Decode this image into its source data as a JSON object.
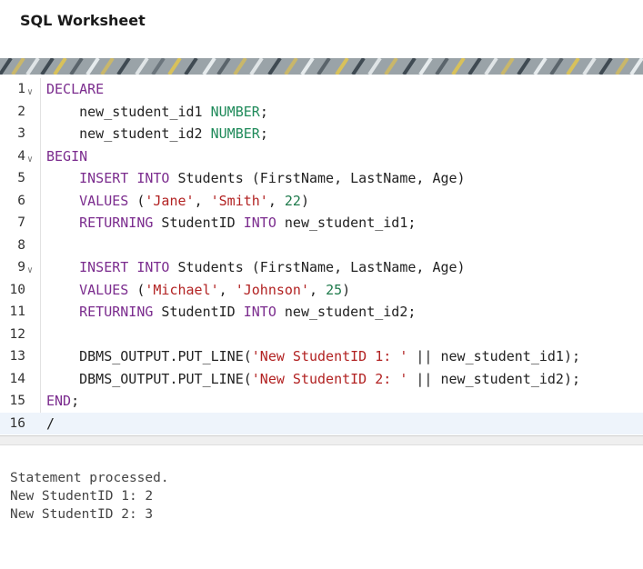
{
  "header": {
    "title": "SQL Worksheet"
  },
  "editor": {
    "lines": [
      {
        "n": "1",
        "fold": true,
        "tokens": [
          {
            "t": "DECLARE",
            "c": "kw"
          }
        ]
      },
      {
        "n": "2",
        "fold": false,
        "tokens": [
          {
            "t": "    new_student_id1 ",
            "c": ""
          },
          {
            "t": "NUMBER",
            "c": "ty"
          },
          {
            "t": ";",
            "c": ""
          }
        ]
      },
      {
        "n": "3",
        "fold": false,
        "tokens": [
          {
            "t": "    new_student_id2 ",
            "c": ""
          },
          {
            "t": "NUMBER",
            "c": "ty"
          },
          {
            "t": ";",
            "c": ""
          }
        ]
      },
      {
        "n": "4",
        "fold": true,
        "tokens": [
          {
            "t": "BEGIN",
            "c": "kw"
          }
        ]
      },
      {
        "n": "5",
        "fold": false,
        "tokens": [
          {
            "t": "    ",
            "c": ""
          },
          {
            "t": "INSERT INTO",
            "c": "kw"
          },
          {
            "t": " Students (FirstName, LastName, Age)",
            "c": ""
          }
        ]
      },
      {
        "n": "6",
        "fold": false,
        "tokens": [
          {
            "t": "    ",
            "c": ""
          },
          {
            "t": "VALUES",
            "c": "kw"
          },
          {
            "t": " (",
            "c": ""
          },
          {
            "t": "'Jane'",
            "c": "st"
          },
          {
            "t": ", ",
            "c": ""
          },
          {
            "t": "'Smith'",
            "c": "st"
          },
          {
            "t": ", ",
            "c": ""
          },
          {
            "t": "22",
            "c": "nm"
          },
          {
            "t": ")",
            "c": ""
          }
        ]
      },
      {
        "n": "7",
        "fold": false,
        "tokens": [
          {
            "t": "    ",
            "c": ""
          },
          {
            "t": "RETURNING",
            "c": "kw"
          },
          {
            "t": " StudentID ",
            "c": ""
          },
          {
            "t": "INTO",
            "c": "kw"
          },
          {
            "t": " new_student_id1;",
            "c": ""
          }
        ]
      },
      {
        "n": "8",
        "fold": false,
        "tokens": []
      },
      {
        "n": "9",
        "fold": true,
        "tokens": [
          {
            "t": "    ",
            "c": ""
          },
          {
            "t": "INSERT INTO",
            "c": "kw"
          },
          {
            "t": " Students (FirstName, LastName, Age)",
            "c": ""
          }
        ]
      },
      {
        "n": "10",
        "fold": false,
        "tokens": [
          {
            "t": "    ",
            "c": ""
          },
          {
            "t": "VALUES",
            "c": "kw"
          },
          {
            "t": " (",
            "c": ""
          },
          {
            "t": "'Michael'",
            "c": "st"
          },
          {
            "t": ", ",
            "c": ""
          },
          {
            "t": "'Johnson'",
            "c": "st"
          },
          {
            "t": ", ",
            "c": ""
          },
          {
            "t": "25",
            "c": "nm"
          },
          {
            "t": ")",
            "c": ""
          }
        ]
      },
      {
        "n": "11",
        "fold": false,
        "tokens": [
          {
            "t": "    ",
            "c": ""
          },
          {
            "t": "RETURNING",
            "c": "kw"
          },
          {
            "t": " StudentID ",
            "c": ""
          },
          {
            "t": "INTO",
            "c": "kw"
          },
          {
            "t": " new_student_id2;",
            "c": ""
          }
        ]
      },
      {
        "n": "12",
        "fold": false,
        "tokens": []
      },
      {
        "n": "13",
        "fold": false,
        "tokens": [
          {
            "t": "    DBMS_OUTPUT.PUT_LINE(",
            "c": ""
          },
          {
            "t": "'New StudentID 1: '",
            "c": "st"
          },
          {
            "t": " || new_student_id1);",
            "c": ""
          }
        ]
      },
      {
        "n": "14",
        "fold": false,
        "tokens": [
          {
            "t": "    DBMS_OUTPUT.PUT_LINE(",
            "c": ""
          },
          {
            "t": "'New StudentID 2: '",
            "c": "st"
          },
          {
            "t": " || new_student_id2);",
            "c": ""
          }
        ]
      },
      {
        "n": "15",
        "fold": false,
        "tokens": [
          {
            "t": "END",
            "c": "kw"
          },
          {
            "t": ";",
            "c": ""
          }
        ]
      },
      {
        "n": "16",
        "fold": false,
        "active": true,
        "tokens": [
          {
            "t": "/",
            "c": ""
          }
        ]
      }
    ]
  },
  "output": {
    "lines": [
      "Statement processed.",
      "New StudentID 1: 2",
      "New StudentID 2: 3"
    ]
  },
  "icons": {
    "fold": "chevron-down-icon"
  }
}
